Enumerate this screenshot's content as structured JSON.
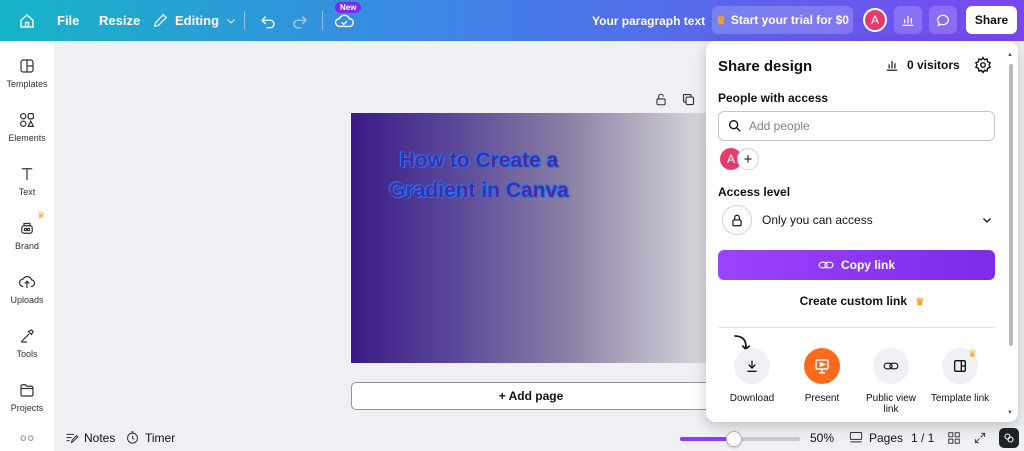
{
  "topbar": {
    "file": "File",
    "resize": "Resize",
    "editing": "Editing",
    "new_badge": "New",
    "doc_title": "Your paragraph text",
    "trial": "Start your trial for $0",
    "avatar": "A",
    "share": "Share"
  },
  "sidebar": {
    "items": [
      {
        "label": "Templates",
        "icon": "templates-icon"
      },
      {
        "label": "Elements",
        "icon": "elements-icon"
      },
      {
        "label": "Text",
        "icon": "text-icon"
      },
      {
        "label": "Brand",
        "icon": "brand-icon"
      },
      {
        "label": "Uploads",
        "icon": "uploads-icon"
      },
      {
        "label": "Tools",
        "icon": "tools-icon"
      },
      {
        "label": "Projects",
        "icon": "projects-icon"
      }
    ]
  },
  "canvas": {
    "title": "How to Create a Gradient in Canva",
    "add_page": "+ Add page"
  },
  "bottombar": {
    "notes": "Notes",
    "timer": "Timer",
    "zoom": "50%",
    "zoom_fraction": 0.45,
    "pages": "Pages",
    "page_count": "1 / 1"
  },
  "share_panel": {
    "title": "Share design",
    "visitors": "0 visitors",
    "people_label": "People with access",
    "add_people_placeholder": "Add people",
    "avatar": "A",
    "access_label": "Access level",
    "access_value": "Only you can access",
    "copy_link": "Copy link",
    "custom_link": "Create custom link",
    "options": [
      {
        "label": "Download",
        "icon": "download-icon"
      },
      {
        "label": "Present",
        "icon": "present-icon"
      },
      {
        "label": "Public view link",
        "icon": "link-icon"
      },
      {
        "label": "Template link",
        "icon": "template-link-icon"
      }
    ]
  },
  "colors": {
    "brand_purple": "#7d2ae8",
    "present_orange": "#ff6a1a",
    "crown_gold": "#f5a623"
  }
}
